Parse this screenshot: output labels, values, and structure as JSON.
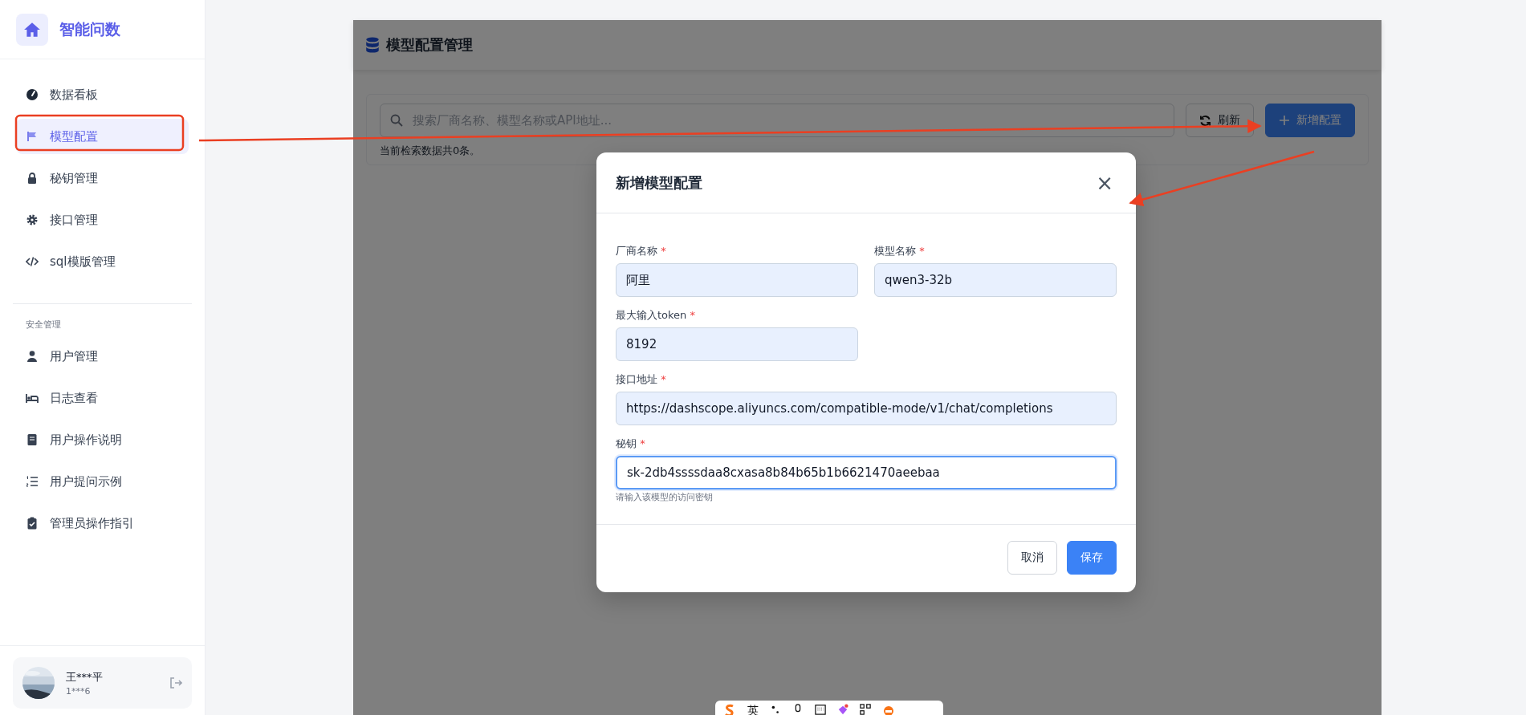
{
  "sidebar": {
    "brand": "智能问数",
    "items": [
      {
        "label": "数据看板",
        "selected": false
      },
      {
        "label": "模型配置",
        "selected": true
      },
      {
        "label": "秘钥管理",
        "selected": false
      },
      {
        "label": "接口管理",
        "selected": false
      },
      {
        "label": "sql模版管理",
        "selected": false
      }
    ],
    "section_title": "安全管理",
    "section_items": [
      {
        "label": "用户管理",
        "selected": false
      },
      {
        "label": "日志查看",
        "selected": false
      },
      {
        "label": "用户操作说明",
        "selected": false
      },
      {
        "label": "用户提问示例",
        "selected": false
      },
      {
        "label": "管理员操作指引",
        "selected": false
      }
    ],
    "user": {
      "name": "王***平",
      "account": "1***6"
    }
  },
  "page": {
    "title": "模型配置管理",
    "search": {
      "placeholder": "搜索厂商名称、模型名称或API地址..."
    },
    "buttons": [
      {
        "label": "刷新",
        "kind": "secondary"
      },
      {
        "label": "新增配置",
        "kind": "primary"
      }
    ],
    "result_text": "当前检索数据共0条。"
  },
  "dialog": {
    "title": "新增模型配置",
    "close": "×",
    "fields": [
      {
        "label": "厂商名称",
        "required_mark": "*",
        "value": "阿里",
        "wide": false,
        "focused": false
      },
      {
        "label": "模型名称",
        "required_mark": "*",
        "value": "qwen3-32b",
        "wide": false,
        "focused": false
      },
      {
        "label": "最大输入token",
        "required_mark": "*",
        "value": "8192",
        "wide": false,
        "focused": false
      },
      {
        "label": "接口地址",
        "required_mark": "*",
        "value": "https://dashscope.aliyuncs.com/compatible-mode/v1/chat/completions",
        "wide": true,
        "focused": false
      },
      {
        "label": "秘钥",
        "required_mark": "*",
        "value": "sk-2db4ssssdaa8cxasa8b84b65b1b6621470aeebaa",
        "wide": true,
        "focused": true,
        "hint": "请输入该模型的访问密钥"
      }
    ],
    "buttons": [
      {
        "label": "取消",
        "kind": "secondary"
      },
      {
        "label": "保存",
        "kind": "primary"
      }
    ]
  },
  "ime_toolbar": {
    "mode": "英"
  }
}
